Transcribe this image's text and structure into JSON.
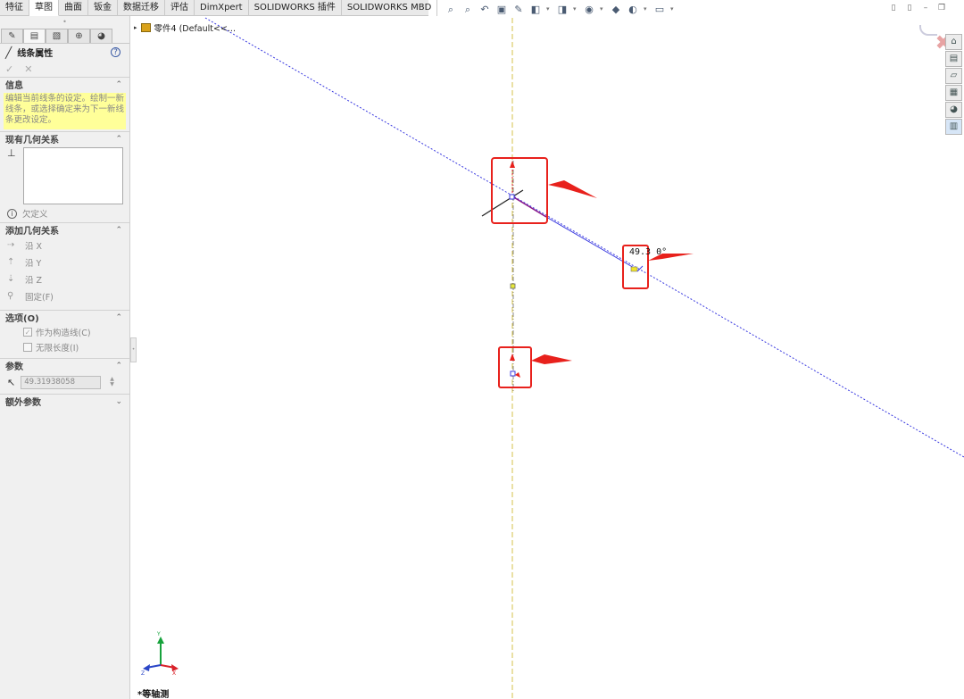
{
  "tabs": [
    {
      "label": "特征"
    },
    {
      "label": "草图"
    },
    {
      "label": "曲面"
    },
    {
      "label": "钣金"
    },
    {
      "label": "数据迁移"
    },
    {
      "label": "评估"
    },
    {
      "label": "DimXpert"
    },
    {
      "label": "SOLIDWORKS 插件"
    },
    {
      "label": "SOLIDWORKS MBD"
    }
  ],
  "active_tab": "草图",
  "tree": {
    "part_label": "零件4 (Default<<..."
  },
  "panel": {
    "title": "线条属性",
    "help_glyph": "?",
    "ok_glyph": "✓",
    "cancel_glyph": "✕",
    "info": {
      "heading": "信息",
      "text": "编辑当前线条的设定。绘制一新线条，或选择确定来为下一新线条更改设定。"
    },
    "existing_relations": {
      "heading": "现有几何关系",
      "status": "欠定义"
    },
    "add_relations": {
      "heading": "添加几何关系",
      "items": [
        "沿 X",
        "沿 Y",
        "沿 Z",
        "固定(F)"
      ]
    },
    "options": {
      "heading": "选项(O)",
      "items": [
        {
          "label": "作为构造线(C)",
          "checked": true
        },
        {
          "label": "无限长度(I)",
          "checked": false
        }
      ]
    },
    "parameters": {
      "heading": "参数",
      "value": "49.31938058"
    },
    "extra": {
      "heading": "额外参数"
    }
  },
  "sketch": {
    "dim_label": "49.3  0°",
    "view_name": "*等轴测"
  },
  "colors": {
    "construction_line": "#3a3ae0",
    "highlight_red": "#e8211c",
    "info_yellow": "#ffff99",
    "axis_yellow": "#d6c24a"
  }
}
